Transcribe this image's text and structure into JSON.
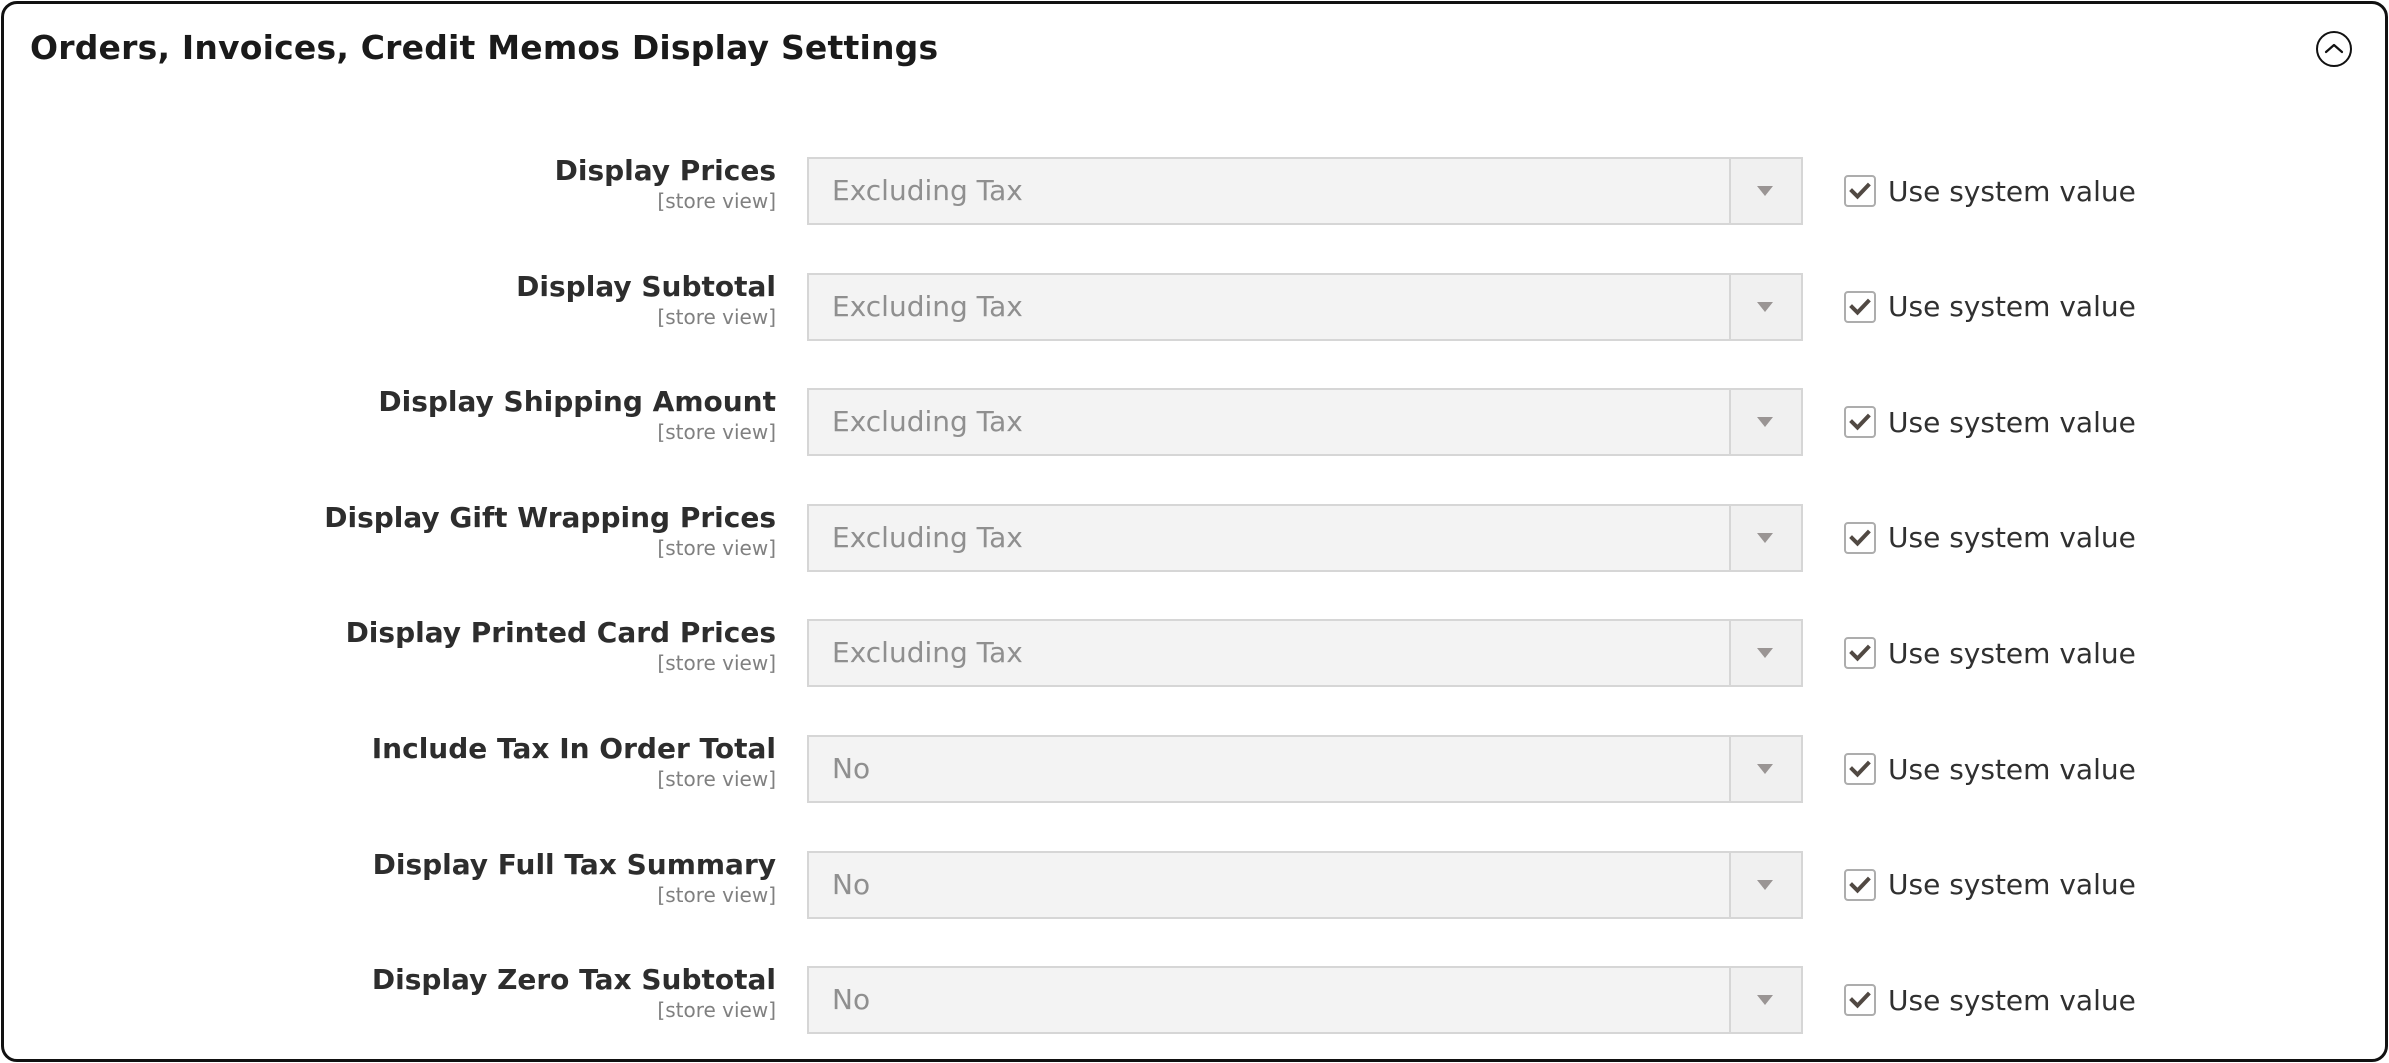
{
  "section": {
    "title": "Orders, Invoices, Credit Memos Display Settings",
    "collapse_icon": "chevron-up-circle-icon",
    "expanded": true
  },
  "fields": [
    {
      "label": "Display Prices",
      "scope": "[store view]",
      "value": "Excluding Tax",
      "use_system_value": true,
      "use_system_value_label": "Use system value"
    },
    {
      "label": "Display Subtotal",
      "scope": "[store view]",
      "value": "Excluding Tax",
      "use_system_value": true,
      "use_system_value_label": "Use system value"
    },
    {
      "label": "Display Shipping Amount",
      "scope": "[store view]",
      "value": "Excluding Tax",
      "use_system_value": true,
      "use_system_value_label": "Use system value"
    },
    {
      "label": "Display Gift Wrapping Prices",
      "scope": "[store view]",
      "value": "Excluding Tax",
      "use_system_value": true,
      "use_system_value_label": "Use system value"
    },
    {
      "label": "Display Printed Card Prices",
      "scope": "[store view]",
      "value": "Excluding Tax",
      "use_system_value": true,
      "use_system_value_label": "Use system value"
    },
    {
      "label": "Include Tax In Order Total",
      "scope": "[store view]",
      "value": "No",
      "use_system_value": true,
      "use_system_value_label": "Use system value"
    },
    {
      "label": "Display Full Tax Summary",
      "scope": "[store view]",
      "value": "No",
      "use_system_value": true,
      "use_system_value_label": "Use system value"
    },
    {
      "label": "Display Zero Tax Subtotal",
      "scope": "[store view]",
      "value": "No",
      "use_system_value": true,
      "use_system_value_label": "Use system value"
    }
  ],
  "colors": {
    "panel_border": "#111111",
    "label_text": "#2d2d2d",
    "scope_text": "#808080",
    "select_bg": "#f3f3f3",
    "select_border": "#d6d6d6",
    "select_text_disabled": "#8f8f8f",
    "checkmark": "#514943"
  }
}
